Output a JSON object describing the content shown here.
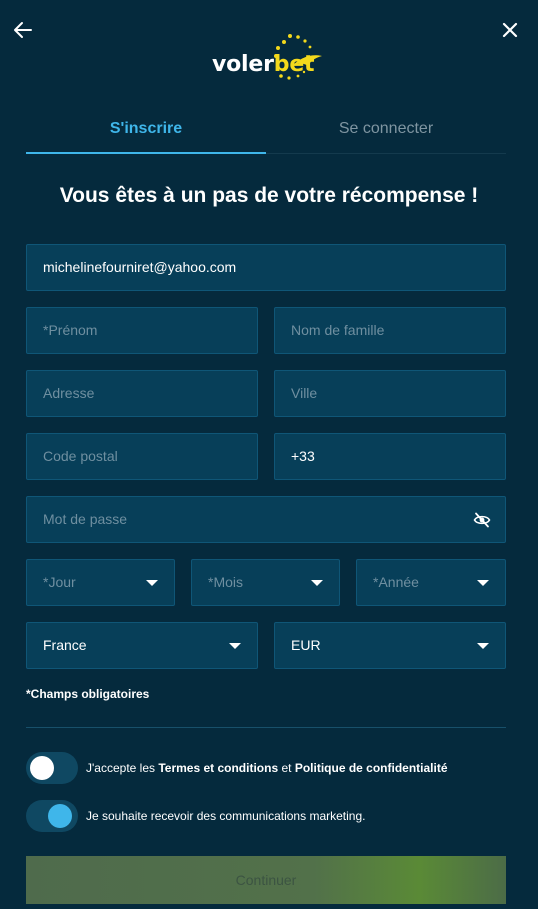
{
  "logo": {
    "part1": "voler",
    "part2": "bet"
  },
  "tabs": {
    "register": "S'inscrire",
    "login": "Se connecter"
  },
  "headline": "Vous êtes à un pas de votre récompense !",
  "form": {
    "email": "michelinefourniret@yahoo.com",
    "first_name_placeholder": "*Prénom",
    "last_name_placeholder": "Nom de famille",
    "address_placeholder": "Adresse",
    "city_placeholder": "Ville",
    "postal_placeholder": "Code postal",
    "phone_value": "+33",
    "password_placeholder": "Mot de passe",
    "day_placeholder": "*Jour",
    "month_placeholder": "*Mois",
    "year_placeholder": "*Année",
    "country_value": "France",
    "currency_value": "EUR"
  },
  "required_note": "*Champs obligatoires",
  "consent": {
    "terms_prefix": "J'accepte les ",
    "terms_link": "Termes et conditions",
    "terms_mid": " et ",
    "privacy_link": "Politique de confidentialité",
    "terms_checked": false,
    "marketing_label": "Je souhaite recevoir des communications marketing.",
    "marketing_checked": true
  },
  "continue_label": "Continuer",
  "colors": {
    "background": "#052a3d",
    "accent": "#3fb6ea",
    "brand_yellow": "#f3d91c"
  },
  "icons": [
    "back-arrow-icon",
    "close-icon",
    "eye-off-icon",
    "chevron-down-icon"
  ]
}
